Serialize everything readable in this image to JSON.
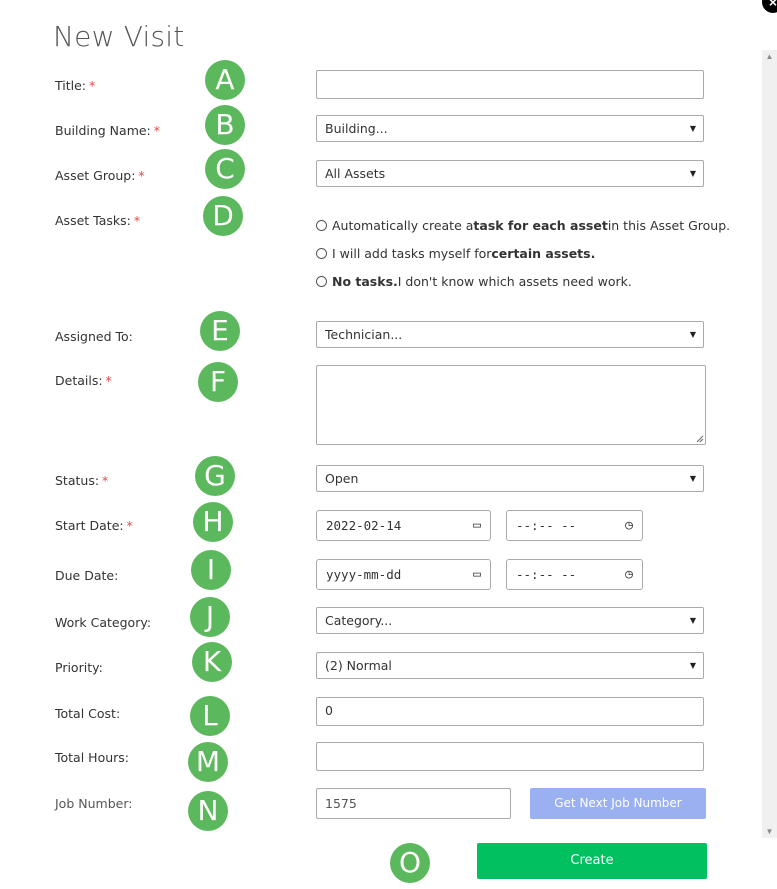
{
  "dialog": {
    "title": "New Visit",
    "close": "×"
  },
  "required_mark": "*",
  "markers": [
    "A",
    "B",
    "C",
    "D",
    "E",
    "F",
    "G",
    "H",
    "I",
    "J",
    "K",
    "L",
    "M",
    "N",
    "O"
  ],
  "labels": {
    "title": "Title:",
    "building": "Building Name:",
    "asset_group": "Asset Group:",
    "asset_tasks": "Asset Tasks:",
    "assigned_to": "Assigned To:",
    "details": "Details:",
    "status": "Status:",
    "start_date": "Start Date:",
    "due_date": "Due Date:",
    "work_category": "Work Category:",
    "priority": "Priority:",
    "total_cost": "Total Cost:",
    "total_hours": "Total Hours:",
    "job_number": "Job Number:"
  },
  "fields": {
    "title_value": "",
    "building_selected": "Building...",
    "asset_group_selected": "All Assets",
    "assigned_selected": "Technician...",
    "status_selected": "Open",
    "start_date_value": "2022-02-14",
    "start_time_value": "--:-- --",
    "due_date_value": "yyyy-mm-dd",
    "due_time_value": "--:-- --",
    "category_selected": "Category...",
    "priority_selected": "(2) Normal",
    "total_cost_value": "0",
    "total_hours_value": "",
    "job_number_value": "1575"
  },
  "radios": [
    {
      "pre": "Automatically create a ",
      "bold": "task for each asset",
      "post": " in this Asset Group."
    },
    {
      "pre": "I will add tasks myself for ",
      "bold": "certain assets.",
      "post": ""
    },
    {
      "pre": "",
      "bold": "No tasks.",
      "post": " I don't know which assets need work."
    }
  ],
  "buttons": {
    "next_job": "Get Next Job Number",
    "create": "Create"
  },
  "icons": {
    "caret": "▼",
    "calendar": "▭",
    "clock": "◷"
  },
  "colors": {
    "marker": "#5cb85c",
    "create": "#00c060",
    "next_job": "#9bb0f0",
    "required": "#e44444"
  }
}
